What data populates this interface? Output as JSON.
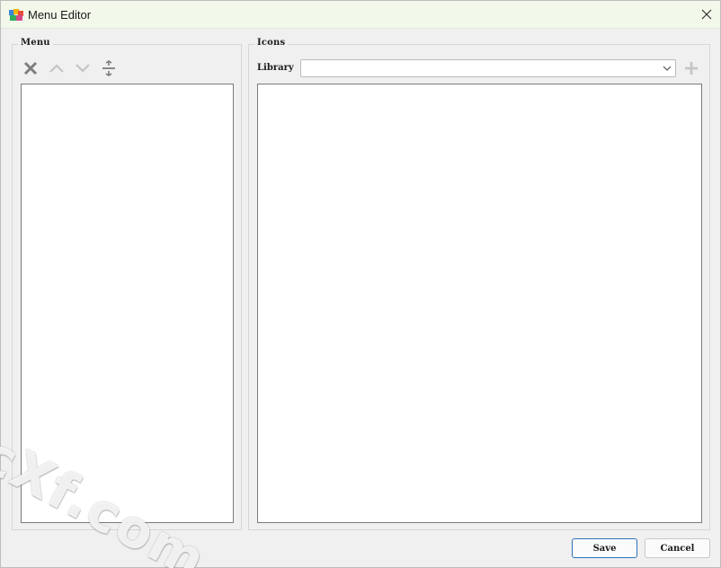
{
  "window": {
    "title": "Menu Editor"
  },
  "icons": {
    "app": "app-palette-icon",
    "close": "close-icon",
    "delete": "delete-x-icon",
    "move_up": "chevron-up-icon",
    "move_down": "chevron-down-icon",
    "separator": "separator-insert-icon",
    "dropdown": "chevron-down-icon",
    "add": "plus-icon"
  },
  "menu_group": {
    "label": "Menu"
  },
  "icons_group": {
    "label": "Icons",
    "library_label": "Library",
    "library_value": ""
  },
  "buttons": {
    "save": "Save",
    "cancel": "Cancel"
  },
  "watermark": {
    "text": "cXf.com"
  },
  "colors": {
    "titlebar_bg": "#f2f8ea",
    "window_bg": "#f0f0f0",
    "default_button_border": "#2f6fba",
    "disabled_icon": "#c4c4c4",
    "active_icon": "#7d7d7d"
  }
}
